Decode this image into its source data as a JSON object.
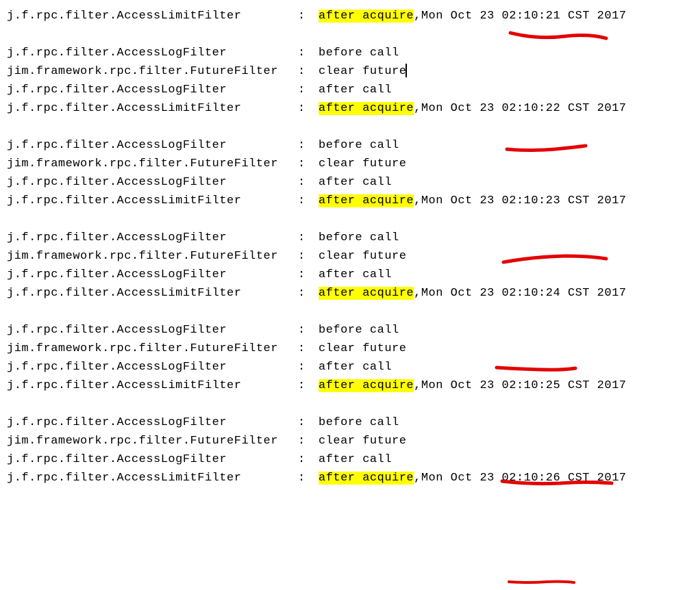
{
  "logger": {
    "accessLimit": "j.f.rpc.filter.AccessLimitFilter",
    "accessLog": "j.f.rpc.filter.AccessLogFilter",
    "future": "jim.framework.rpc.filter.FutureFilter"
  },
  "msg": {
    "afterAcquire": "after acquire",
    "beforeCall": "before call",
    "clearFuture": "clear future",
    "afterCall": "after call"
  },
  "date": {
    "prefix": "Mon Oct 23 ",
    "suffix": " CST 2017"
  },
  "times": {
    "t1": "02:10:21",
    "t2": "02:10:22",
    "t3": "02:10:23",
    "t4": "02:10:24",
    "t5": "02:10:25",
    "t6": "02:10:26"
  },
  "sep": ": "
}
